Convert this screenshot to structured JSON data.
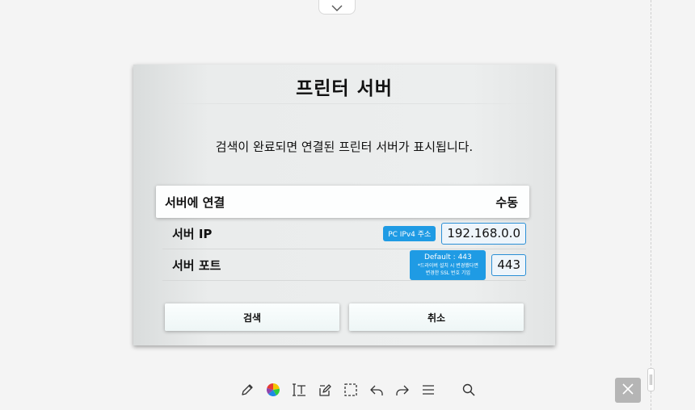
{
  "dialog": {
    "title": "프린터 서버",
    "message": "검색이 완료되면 연결된 프린터 서버가 표시됩니다.",
    "connect": {
      "label": "서버에 연결",
      "mode": "수동"
    },
    "server_ip": {
      "label": "서버 IP",
      "badge": "PC IPv4 주소",
      "value": "192.168.0.0"
    },
    "server_port": {
      "label": "서버 포트",
      "badge_line1": "Default : 443",
      "badge_line2": "*드라이버 설치 시 변경했다면",
      "badge_line3": "변경한 SSL 번호 기입",
      "value": "443"
    },
    "search_label": "검색",
    "cancel_label": "취소"
  },
  "icons": {
    "top_tab": "chevron-down-icon",
    "toolbar": [
      "pen-icon",
      "color-wheel-icon",
      "text-tool-icon",
      "edit-note-icon",
      "select-area-icon",
      "undo-icon",
      "redo-icon",
      "menu-icon",
      "search-icon"
    ],
    "close": "close-icon"
  },
  "colors": {
    "accent": "#1f9be4",
    "close_button": "#b5b5b5"
  }
}
